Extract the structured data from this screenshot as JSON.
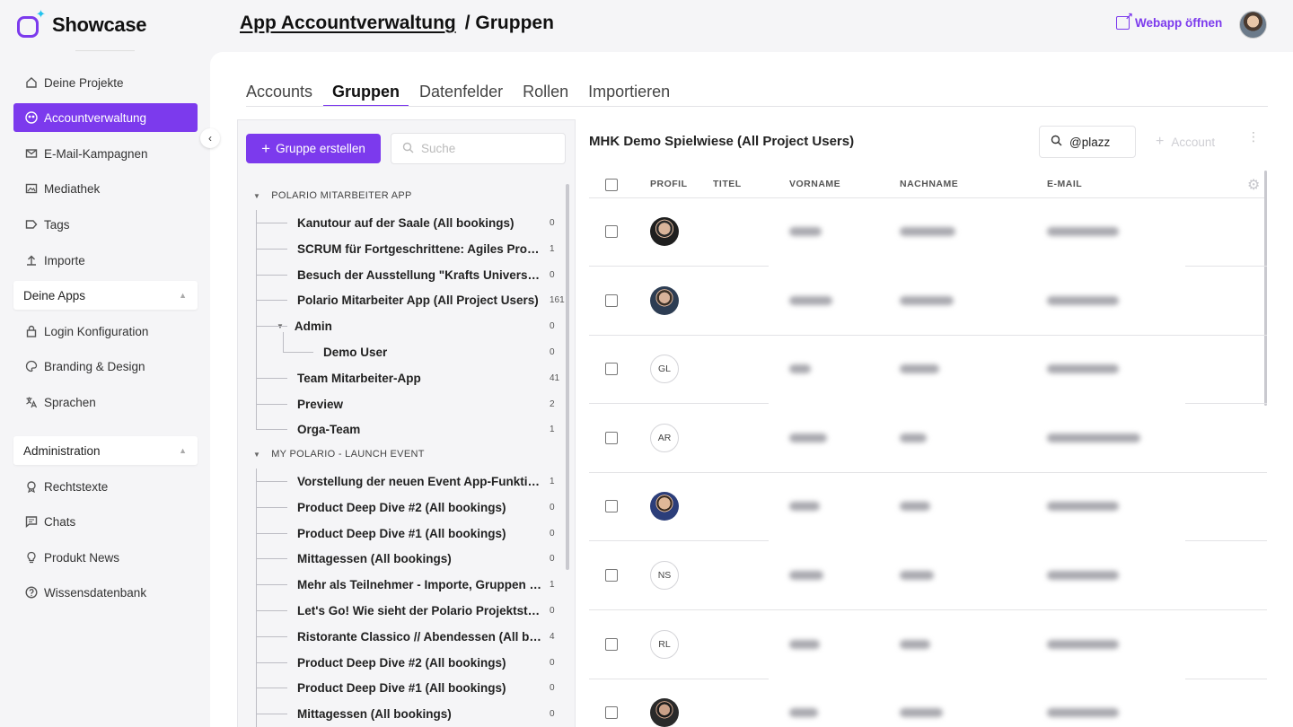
{
  "brand": {
    "name": "Showcase"
  },
  "sidebar": {
    "items": [
      {
        "label": "Deine Projekte",
        "icon": "home-icon"
      },
      {
        "label": "Accountverwaltung",
        "icon": "users-icon",
        "active": true
      },
      {
        "label": "E-Mail-Kampagnen",
        "icon": "mail-icon"
      },
      {
        "label": "Mediathek",
        "icon": "media-icon"
      },
      {
        "label": "Tags",
        "icon": "tag-icon"
      },
      {
        "label": "Importe",
        "icon": "import-icon"
      }
    ],
    "group_apps": "Deine Apps",
    "apps_items": [
      {
        "label": "Login Konfiguration",
        "icon": "lock-icon"
      },
      {
        "label": "Branding & Design",
        "icon": "palette-icon"
      },
      {
        "label": "Sprachen",
        "icon": "translate-icon"
      }
    ],
    "group_admin": "Administration",
    "admin_items": [
      {
        "label": "Rechtstexte",
        "icon": "legal-icon"
      },
      {
        "label": "Chats",
        "icon": "chat-icon"
      },
      {
        "label": "Produkt News",
        "icon": "bulb-icon"
      },
      {
        "label": "Wissensdatenbank",
        "icon": "help-icon"
      }
    ]
  },
  "header": {
    "title_link": "App Accountverwaltung",
    "title_rest": "/ Gruppen",
    "webapp_label": "Webapp öffnen"
  },
  "tabs": [
    "Accounts",
    "Gruppen",
    "Datenfelder",
    "Rollen",
    "Importieren"
  ],
  "groups": {
    "create_label": "Gruppe erstellen",
    "search_placeholder": "Suche",
    "section1": "POLARIO MITARBEITER APP",
    "section1_items": [
      {
        "label": "Kanutour auf der Saale (All bookings)",
        "count": "0"
      },
      {
        "label": "SCRUM für Fortgeschrittene: Agiles Projektmanagement",
        "count": "1"
      },
      {
        "label": "Besuch der Ausstellung \"Krafts Universum\"",
        "count": "0"
      },
      {
        "label": "Polario Mitarbeiter App (All Project Users)",
        "count": "161"
      },
      {
        "label": "Admin",
        "count": "0"
      },
      {
        "label": "Demo User",
        "count": "0"
      },
      {
        "label": "Team Mitarbeiter-App",
        "count": "41"
      },
      {
        "label": "Preview",
        "count": "2"
      },
      {
        "label": "Orga-Team",
        "count": "1"
      }
    ],
    "section2": "MY POLARIO - LAUNCH EVENT",
    "section2_items": [
      {
        "label": "Vorstellung der neuen Event App-Funktionen",
        "count": "1"
      },
      {
        "label": "Product Deep Dive #2 (All bookings)",
        "count": "0"
      },
      {
        "label": "Product Deep Dive #1 (All bookings)",
        "count": "0"
      },
      {
        "label": "Mittagessen (All bookings)",
        "count": "0"
      },
      {
        "label": "Mehr als Teilnehmer - Importe, Gruppen & Rollen",
        "count": "1"
      },
      {
        "label": "Let's Go! Wie sieht der Polario Projektstart aus?",
        "count": "0"
      },
      {
        "label": "Ristorante Classico // Abendessen (All bookings)",
        "count": "4"
      },
      {
        "label": "Product Deep Dive #2 (All bookings)",
        "count": "0"
      },
      {
        "label": "Product Deep Dive #1 (All bookings)",
        "count": "0"
      },
      {
        "label": "Mittagessen (All bookings)",
        "count": "0"
      }
    ]
  },
  "table": {
    "title": "MHK Demo Spielwiese (All Project Users)",
    "search_value": "@plazz",
    "add_label": "Account",
    "columns": [
      "PROFIL",
      "TITEL",
      "VORNAME",
      "NACHNAME",
      "E-MAIL"
    ],
    "rows": [
      {
        "avatar": "photo1"
      },
      {
        "avatar": "photo2"
      },
      {
        "avatar": "initials",
        "initials": "GL"
      },
      {
        "avatar": "initials",
        "initials": "AR"
      },
      {
        "avatar": "photo3"
      },
      {
        "avatar": "initials",
        "initials": "NS"
      },
      {
        "avatar": "initials",
        "initials": "RL"
      },
      {
        "avatar": "photo4"
      }
    ]
  },
  "colors": {
    "accent": "#7c3aed",
    "logo_spark": "#22c3ee"
  }
}
